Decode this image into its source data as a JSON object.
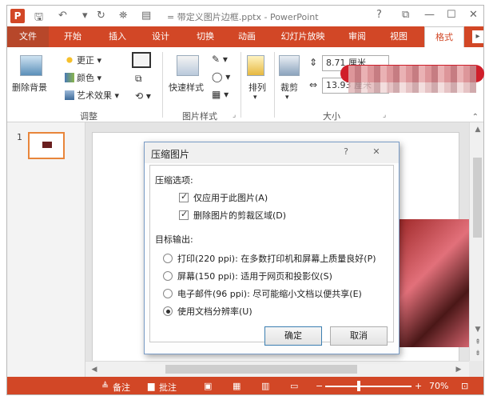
{
  "titlebar": {
    "app_logo": "P",
    "title": "= 带定义图片边框.pptx - PowerPoint",
    "help": "?",
    "restore": "⧉",
    "minimize": "—",
    "maximize": "☐",
    "close": "✕"
  },
  "tabs": [
    {
      "label": "文件"
    },
    {
      "label": "开始"
    },
    {
      "label": "插入"
    },
    {
      "label": "设计"
    },
    {
      "label": "切换"
    },
    {
      "label": "动画"
    },
    {
      "label": "幻灯片放映"
    },
    {
      "label": "审阅"
    },
    {
      "label": "视图"
    },
    {
      "label": "格式"
    }
  ],
  "ribbon": {
    "remove_bg": "删除背景",
    "corrections": "更正",
    "color": "颜色",
    "artistic": "艺术效果",
    "group_adjust": "调整",
    "quick_styles": "快速样式",
    "group_picture_styles": "图片样式",
    "arrange": "排列",
    "crop": "裁剪",
    "height": "8.71 厘米",
    "width": "13.93 厘米",
    "group_size": "大小"
  },
  "thumbnails": {
    "slide_number": "1"
  },
  "dialog": {
    "title": "压缩图片",
    "help": "?",
    "close": "✕",
    "compress_options_label": "压缩选项:",
    "only_this_picture": "仅应用于此图片(A)",
    "delete_cropped": "删除图片的剪裁区域(D)",
    "target_output_label": "目标输出:",
    "print_option": "打印(220 ppi): 在多数打印机和屏幕上质量良好(P)",
    "screen_option": "屏幕(150 ppi): 适用于网页和投影仪(S)",
    "email_option": "电子邮件(96 ppi): 尽可能缩小文档以便共享(E)",
    "document_resolution": "使用文档分辨率(U)",
    "ok": "确定",
    "cancel": "取消",
    "selected_output": "document_resolution"
  },
  "statusbar": {
    "notes": "备注",
    "comments": "批注",
    "zoom_minus": "−",
    "zoom_plus": "+",
    "zoom": "70%"
  },
  "colors": {
    "accent": "#d24726",
    "banner": "#d01f2a"
  }
}
